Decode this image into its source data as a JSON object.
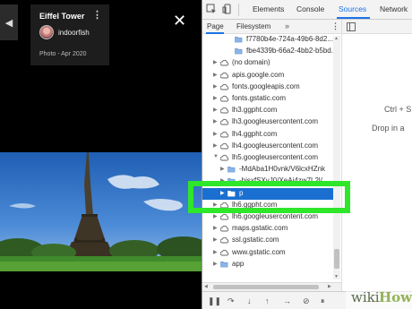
{
  "viewer": {
    "prev_arrow": "◀",
    "title": "Eiffel Tower",
    "user": "indoorfish",
    "date": "Photo - Apr 2020",
    "menu": "⋮",
    "close": "✕"
  },
  "devtools": {
    "tabs": [
      "Elements",
      "Console",
      "Sources",
      "Network"
    ],
    "active_tab": "Sources",
    "subtabs": [
      "Page",
      "Filesystem"
    ],
    "subtab_more": "»",
    "kebab": "⋮",
    "editor_hint_1": "Ctrl + S",
    "editor_hint_2": "Drop in a",
    "tree": [
      {
        "label": "f7780b4e-724a-49b6-8d2...",
        "kind": "folder",
        "indent": 3,
        "arrow": ""
      },
      {
        "label": "fbe4339b-66a2-4bb2-b5bd...",
        "kind": "folder",
        "indent": 3,
        "arrow": ""
      },
      {
        "label": "(no domain)",
        "kind": "cloud",
        "indent": 1,
        "arrow": "▶"
      },
      {
        "label": "apis.google.com",
        "kind": "cloud",
        "indent": 1,
        "arrow": "▶"
      },
      {
        "label": "fonts.googleapis.com",
        "kind": "cloud",
        "indent": 1,
        "arrow": "▶"
      },
      {
        "label": "fonts.gstatic.com",
        "kind": "cloud",
        "indent": 1,
        "arrow": "▶"
      },
      {
        "label": "lh3.ggpht.com",
        "kind": "cloud",
        "indent": 1,
        "arrow": "▶"
      },
      {
        "label": "lh3.googleusercontent.com",
        "kind": "cloud",
        "indent": 1,
        "arrow": "▶"
      },
      {
        "label": "lh4.ggpht.com",
        "kind": "cloud",
        "indent": 1,
        "arrow": "▶"
      },
      {
        "label": "lh4.googleusercontent.com",
        "kind": "cloud",
        "indent": 1,
        "arrow": "▶"
      },
      {
        "label": "lh5.googleusercontent.com",
        "kind": "cloud",
        "indent": 1,
        "arrow": "▼"
      },
      {
        "label": "-MdAba1H0vnk/V6lcxHZnk",
        "kind": "folder",
        "indent": 2,
        "arrow": "▶"
      },
      {
        "label": "-hisxfSXvJ0/XeAi4zw7L2l/...",
        "kind": "folder",
        "indent": 2,
        "arrow": "▶"
      },
      {
        "label": "p",
        "kind": "folder",
        "indent": 2,
        "arrow": "▶",
        "selected": true
      },
      {
        "label": "lh6.ggpht.com",
        "kind": "cloud",
        "indent": 1,
        "arrow": "▶"
      },
      {
        "label": "lh6.googleusercontent.com",
        "kind": "cloud",
        "indent": 1,
        "arrow": "▶"
      },
      {
        "label": "maps.gstatic.com",
        "kind": "cloud",
        "indent": 1,
        "arrow": "▶"
      },
      {
        "label": "ssl.gstatic.com",
        "kind": "cloud",
        "indent": 1,
        "arrow": "▶"
      },
      {
        "label": "www.gstatic.com",
        "kind": "cloud",
        "indent": 1,
        "arrow": "▶"
      },
      {
        "label": "app",
        "kind": "folder",
        "indent": 1,
        "arrow": "▶"
      }
    ],
    "debug_icons": [
      "❚❚",
      "↷",
      "↓",
      "↑",
      "→",
      "⊘",
      "⏸"
    ]
  },
  "colors": {
    "accent": "#1a73e8",
    "selection": "#1a6fd1",
    "highlight": "#2ee62a"
  },
  "watermark": {
    "wiki": "wiki",
    "how": "How"
  }
}
